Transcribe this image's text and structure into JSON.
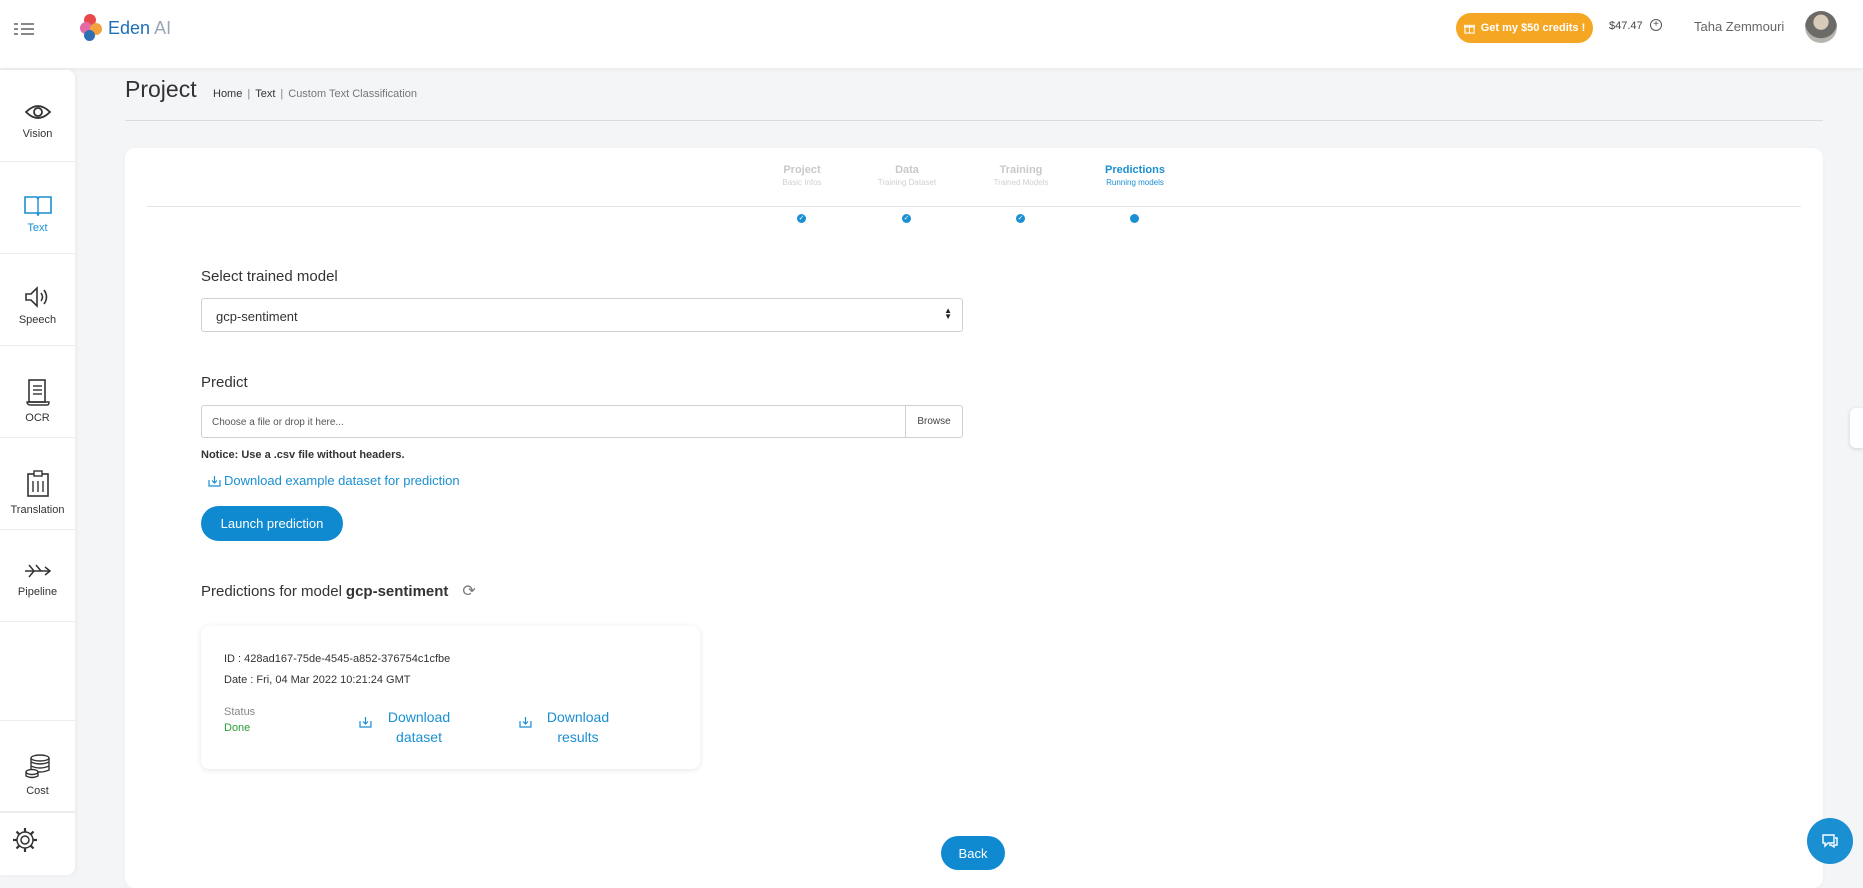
{
  "header": {
    "logo_name": "Eden",
    "logo_suffix": "AI",
    "credits_button": "Get my $50 credits !",
    "balance": "$47.47",
    "username": "Taha Zemmouri"
  },
  "sidebar": {
    "items": [
      {
        "label": "Vision",
        "icon": "eye-icon"
      },
      {
        "label": "Text",
        "icon": "book-icon",
        "active": true
      },
      {
        "label": "Speech",
        "icon": "speaker-icon"
      },
      {
        "label": "OCR",
        "icon": "scroll-icon"
      },
      {
        "label": "Translation",
        "icon": "clipboard-icon"
      },
      {
        "label": "Pipeline",
        "icon": "pipeline-icon"
      },
      {
        "label": "Cost",
        "icon": "coins-icon"
      }
    ],
    "settings_icon": "gear-icon"
  },
  "page": {
    "title": "Project",
    "breadcrumb": [
      "Home",
      "Text",
      "Custom Text Classification"
    ]
  },
  "stepper": {
    "steps": [
      {
        "title": "Project",
        "subtitle": "Basic Infos"
      },
      {
        "title": "Data",
        "subtitle": "Training Dataset"
      },
      {
        "title": "Training",
        "subtitle": "Trained Models"
      },
      {
        "title": "Predictions",
        "subtitle": "Running models"
      }
    ],
    "active_index": 3
  },
  "form": {
    "select_label": "Select trained model",
    "select_value": "gcp-sentiment",
    "predict_label": "Predict",
    "file_placeholder": "Choose a file or drop it here...",
    "browse_label": "Browse",
    "notice": "Notice: Use a .csv file without headers.",
    "download_example": "Download example dataset for prediction",
    "launch_button": "Launch prediction"
  },
  "predictions": {
    "title_prefix": "Predictions for model",
    "model_name": "gcp-sentiment",
    "items": [
      {
        "id": "ID : 428ad167-75de-4545-a852-376754c1cfbe",
        "date": "Date : Fri, 04 Mar 2022 10:21:24 GMT",
        "status_label": "Status",
        "status_value": "Done",
        "download_dataset_1": "Download",
        "download_dataset_2": "dataset",
        "download_results_1": "Download",
        "download_results_2": "results"
      }
    ]
  },
  "footer": {
    "back_button": "Back"
  },
  "colors": {
    "accent": "#1a8fd2",
    "credits": "#f5a623",
    "done": "#2a9d3a"
  }
}
